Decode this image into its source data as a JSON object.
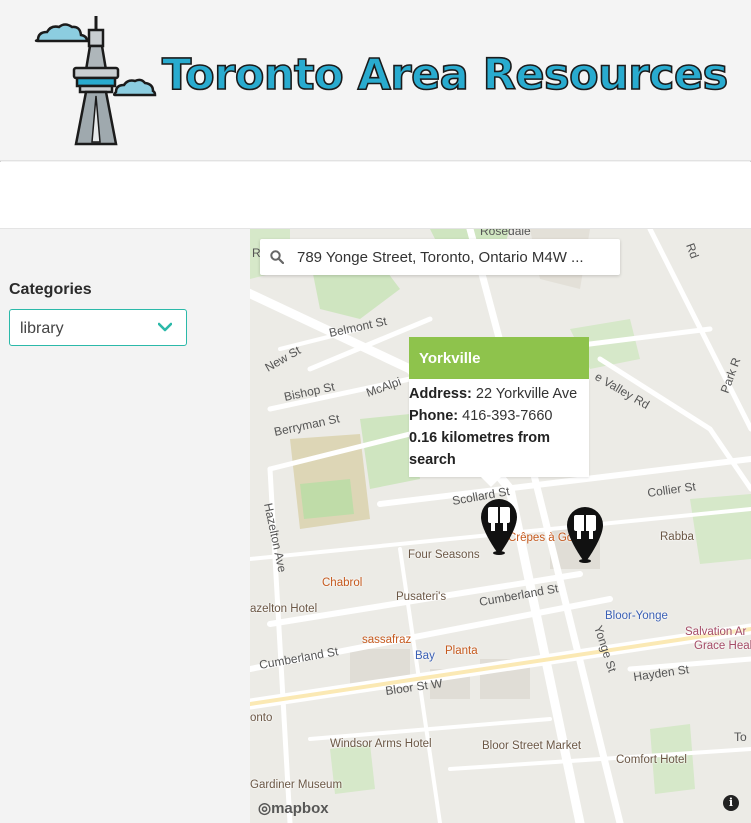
{
  "header": {
    "title": "Toronto Area Resources",
    "logo_icon": "cn-tower-icon",
    "title_color": "#29abcf"
  },
  "sidebar": {
    "categories_label": "Categories",
    "category_selected": "library",
    "accent_color": "#2bb9a9"
  },
  "map": {
    "search_value": "789 Yonge Street, Toronto, Ontario M4W ...",
    "popup": {
      "title": "Yorkville",
      "address_label": "Address:",
      "address": "22 Yorkville Ave",
      "phone_label": "Phone:",
      "phone": "416-393-7660",
      "distance_text": "0.16 kilometres from search",
      "header_color": "#8ec34c"
    },
    "streets": {
      "rosedale": "Rosedale",
      "rd": "Rd",
      "belmont": "Belmont St",
      "new_st": "New St",
      "bishop": "Bishop St",
      "mcalpine": "McAlpi",
      "berryman": "Berryman St",
      "hazelton": "Hazelton Ave",
      "scollard": "Scollard St",
      "collier": "Collier St",
      "cumberland1": "Cumberland St",
      "cumberland2": "Cumberland St",
      "bloor": "Bloor St W",
      "yonge": "Yonge St",
      "hayden": "Hayden St",
      "valley": "e Valley Rd",
      "park": "Park R",
      "r_letter": "R",
      "to": "To"
    },
    "pois": {
      "four_seasons": "Four Seasons",
      "chabrol": "Chabrol",
      "pusateris": "Pusateri's",
      "hazelton_hotel": "azelton Hotel",
      "sassafraz": "sassafraz",
      "bay": "Bay",
      "planta": "Planta",
      "crepes": "Crêpes à Gogo",
      "rabba": "Rabba",
      "bloor_yonge": "Bloor-Yonge",
      "salvation_army": "Salvation Ar",
      "grace_health": "Grace Heal",
      "ontario": "onto",
      "windsor_arms": "Windsor Arms Hotel",
      "bloor_street_market": "Bloor Street Market",
      "gardiner": "Gardiner Museum",
      "comfort_hotel": "Comfort Hotel"
    },
    "attribution": "mapbox",
    "info_label": "i",
    "markers": [
      "library-marker-icon",
      "library-marker-icon"
    ]
  }
}
